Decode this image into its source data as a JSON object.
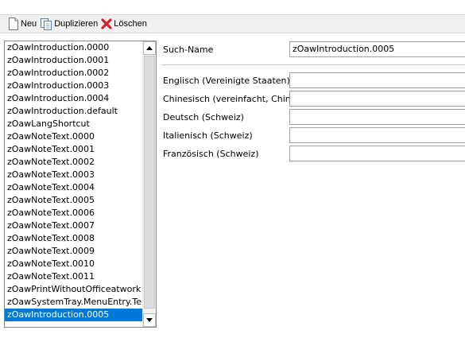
{
  "toolbar": {
    "new_label": "Neu",
    "duplicate_label": "Duplizieren",
    "delete_label": "Löschen"
  },
  "list": {
    "items": [
      "zOawIntroduction.0000",
      "zOawIntroduction.0001",
      "zOawIntroduction.0002",
      "zOawIntroduction.0003",
      "zOawIntroduction.0004",
      "zOawIntroduction.default",
      "zOawLangShortcut",
      "zOawNoteText.0000",
      "zOawNoteText.0001",
      "zOawNoteText.0002",
      "zOawNoteText.0003",
      "zOawNoteText.0004",
      "zOawNoteText.0005",
      "zOawNoteText.0006",
      "zOawNoteText.0007",
      "zOawNoteText.0008",
      "zOawNoteText.0009",
      "zOawNoteText.0010",
      "zOawNoteText.0011",
      "zOawPrintWithoutOfficeatwork",
      "zOawSystemTray.MenuEntry.Te...",
      "zOawIntroduction.0005"
    ],
    "selected_index": 21
  },
  "form": {
    "search_name_label": "Such-Name",
    "search_name_value": "zOawIntroduction.0005",
    "languages": [
      {
        "label": "Englisch (Vereinigte Staaten)",
        "value": ""
      },
      {
        "label": "Chinesisch (vereinfacht, China)",
        "value": ""
      },
      {
        "label": "Deutsch (Schweiz)",
        "value": ""
      },
      {
        "label": "Italienisch (Schweiz)",
        "value": ""
      },
      {
        "label": "Französisch (Schweiz)",
        "value": ""
      }
    ]
  },
  "colors": {
    "selection": "#0078d7",
    "delete_icon": "#d4202a"
  }
}
